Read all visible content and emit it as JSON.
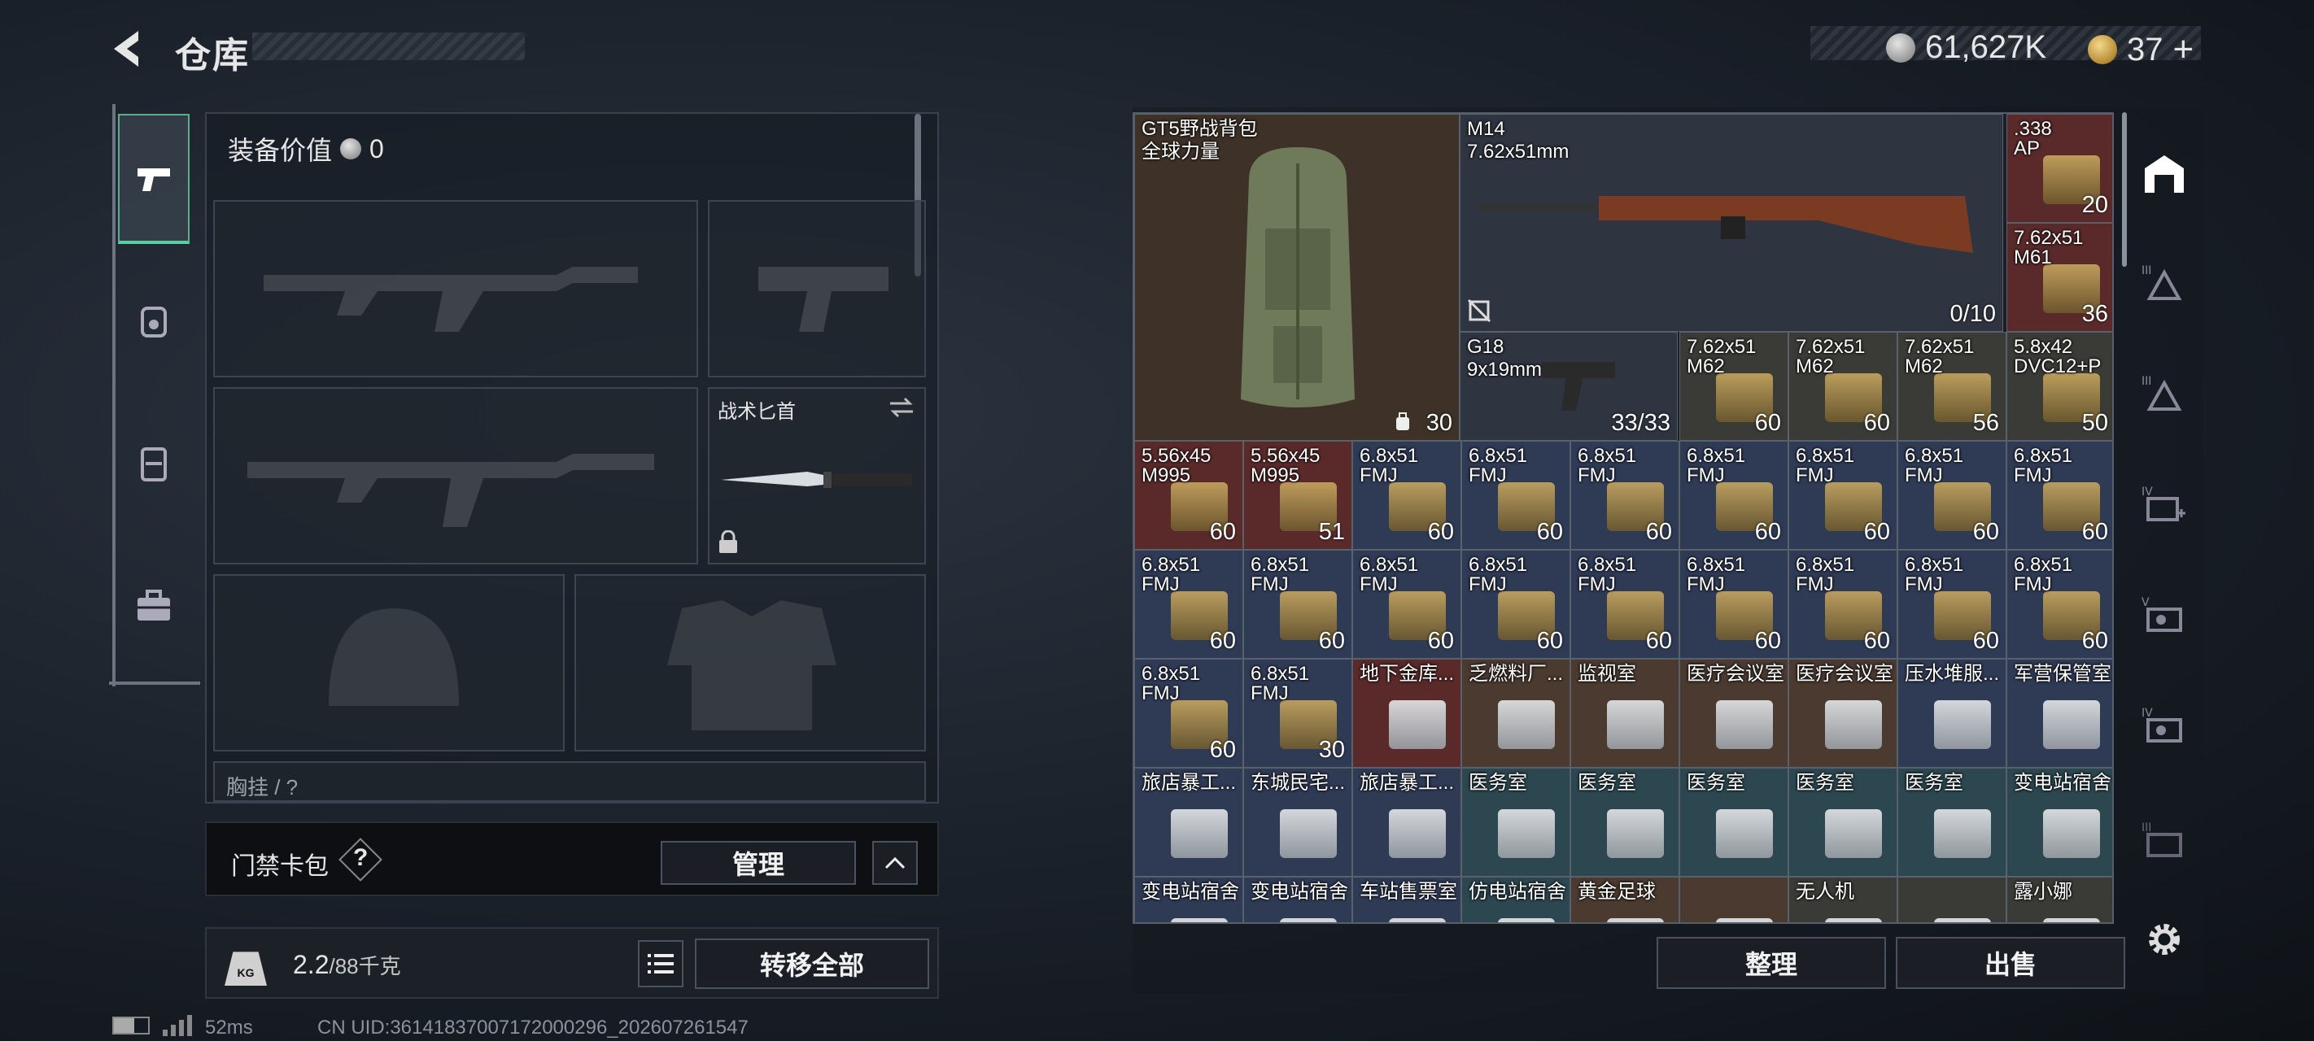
{
  "header": {
    "title": "仓库",
    "silver": "61,627K",
    "gold": "37",
    "gold_plus": "+"
  },
  "equipment": {
    "value_label": "装备价值",
    "value": "0",
    "knife_label": "战术匕首",
    "chest_label": "胸挂 / ?"
  },
  "keycard": {
    "label": "门禁卡包",
    "help": "?",
    "manage": "管理"
  },
  "weight": {
    "current": "2.2",
    "capacity": "/88千克",
    "transfer_all": "转移全部",
    "kg_icon_text": "KG"
  },
  "actions": {
    "sort": "整理",
    "sell": "出售"
  },
  "status": {
    "ping": "52ms",
    "uid": "CN UID:36141837007172000296_202607261547"
  },
  "grid": {
    "backpack": {
      "name": "GT5野战背包",
      "sub": "全球力量",
      "count": "30"
    },
    "m14": {
      "name": "M14",
      "sub": "7.62x51mm",
      "count": "0/10"
    },
    "g18": {
      "name": "G18",
      "sub": "9x19mm",
      "count": "33/33"
    },
    "cells": [
      {
        "name": ".338\nAP",
        "count": "20",
        "bg": "#5a2a2a"
      },
      {
        "name": "7.62x51\nM61",
        "count": "36",
        "bg": "#5a2a2a"
      },
      {
        "name": "7.62x51\nM62",
        "count": "60",
        "bg": "#3a3a36"
      },
      {
        "name": "7.62x51\nM62",
        "count": "60",
        "bg": "#3a3a36"
      },
      {
        "name": "7.62x51\nM62",
        "count": "56",
        "bg": "#3a3a36"
      },
      {
        "name": "5.8x42\nDVC12+P",
        "count": "50",
        "bg": "#3a3a36"
      },
      {
        "name": "5.56x45\nM995",
        "count": "60",
        "bg": "#5a2a2a"
      },
      {
        "name": "5.56x45\nM995",
        "count": "51",
        "bg": "#5a2a2a"
      },
      {
        "name": "6.8x51\nFMJ",
        "count": "60",
        "bg": "#2f3b55"
      },
      {
        "name": "6.8x51\nFMJ",
        "count": "60",
        "bg": "#2f3b55"
      },
      {
        "name": "6.8x51\nFMJ",
        "count": "60",
        "bg": "#2f3b55"
      },
      {
        "name": "6.8x51\nFMJ",
        "count": "60",
        "bg": "#2f3b55"
      },
      {
        "name": "6.8x51\nFMJ",
        "count": "60",
        "bg": "#2f3b55"
      },
      {
        "name": "6.8x51\nFMJ",
        "count": "60",
        "bg": "#2f3b55"
      },
      {
        "name": "6.8x51\nFMJ",
        "count": "60",
        "bg": "#2f3b55"
      },
      {
        "name": "6.8x51\nFMJ",
        "count": "60",
        "bg": "#2f3b55"
      },
      {
        "name": "6.8x51\nFMJ",
        "count": "60",
        "bg": "#2f3b55"
      },
      {
        "name": "6.8x51\nFMJ",
        "count": "60",
        "bg": "#2f3b55"
      },
      {
        "name": "6.8x51\nFMJ",
        "count": "60",
        "bg": "#2f3b55"
      },
      {
        "name": "6.8x51\nFMJ",
        "count": "60",
        "bg": "#2f3b55"
      },
      {
        "name": "6.8x51\nFMJ",
        "count": "60",
        "bg": "#2f3b55"
      },
      {
        "name": "6.8x51\nFMJ",
        "count": "60",
        "bg": "#2f3b55"
      },
      {
        "name": "6.8x51\nFMJ",
        "count": "60",
        "bg": "#2f3b55"
      },
      {
        "name": "6.8x51\nFMJ",
        "count": "60",
        "bg": "#2f3b55"
      },
      {
        "name": "6.8x51\nFMJ",
        "count": "60",
        "bg": "#2f3b55"
      },
      {
        "name": "6.8x51\nFMJ",
        "count": "30",
        "bg": "#2f3b55"
      },
      {
        "name": "地下金库...",
        "count": "",
        "bg": "#5a2a2a"
      },
      {
        "name": "乏燃料厂...",
        "count": "",
        "bg": "#4a3a30"
      },
      {
        "name": "监视室",
        "count": "",
        "bg": "#4a3a30"
      },
      {
        "name": "医疗会议室",
        "count": "",
        "bg": "#4a3a30"
      },
      {
        "name": "医疗会议室",
        "count": "",
        "bg": "#4a3a30"
      },
      {
        "name": "压水堆服...",
        "count": "",
        "bg": "#2f3b55"
      },
      {
        "name": "军营保管室",
        "count": "",
        "bg": "#2f3b55"
      },
      {
        "name": "旅店暴工...",
        "count": "",
        "bg": "#2f3b55"
      },
      {
        "name": "东城民宅...",
        "count": "",
        "bg": "#2f3b55"
      },
      {
        "name": "旅店暴工...",
        "count": "",
        "bg": "#2f3b55"
      },
      {
        "name": "医务室",
        "count": "",
        "bg": "#2c4750"
      },
      {
        "name": "医务室",
        "count": "",
        "bg": "#2c4750"
      },
      {
        "name": "医务室",
        "count": "",
        "bg": "#2c4750"
      },
      {
        "name": "医务室",
        "count": "",
        "bg": "#2c4750"
      },
      {
        "name": "医务室",
        "count": "",
        "bg": "#2c4750"
      },
      {
        "name": "变电站宿舍",
        "count": "",
        "bg": "#2c4750"
      },
      {
        "name": "变电站宿舍",
        "count": "",
        "bg": "#2f3b55"
      },
      {
        "name": "变电站宿舍",
        "count": "",
        "bg": "#2f3b55"
      },
      {
        "name": "车站售票室",
        "count": "",
        "bg": "#2f3b55"
      },
      {
        "name": "仿电站宿舍",
        "count": "",
        "bg": "#2c4750"
      },
      {
        "name": "黄金足球",
        "count": "",
        "bg": "#4a3a30"
      },
      {
        "name": "",
        "count": "",
        "bg": "#4a3a30"
      },
      {
        "name": "无人机",
        "count": "",
        "bg": "#3a3a36"
      },
      {
        "name": "",
        "count": "",
        "bg": "#3a3a36"
      },
      {
        "name": "露小娜",
        "count": "",
        "bg": "#3a3a36"
      }
    ]
  },
  "left_tabs": [
    "pistol-icon",
    "armor-rig-icon",
    "backpack-icon",
    "briefcase-icon"
  ],
  "right_tabs": [
    "warehouse-icon",
    "tier-iii-armor-icon",
    "tier-ii-armor-icon",
    "tier-iv-medkit-icon",
    "tier-v-case-icon",
    "tier-iv-case-icon",
    "tier-iii-case-icon"
  ],
  "settings_icon": "gear-icon"
}
